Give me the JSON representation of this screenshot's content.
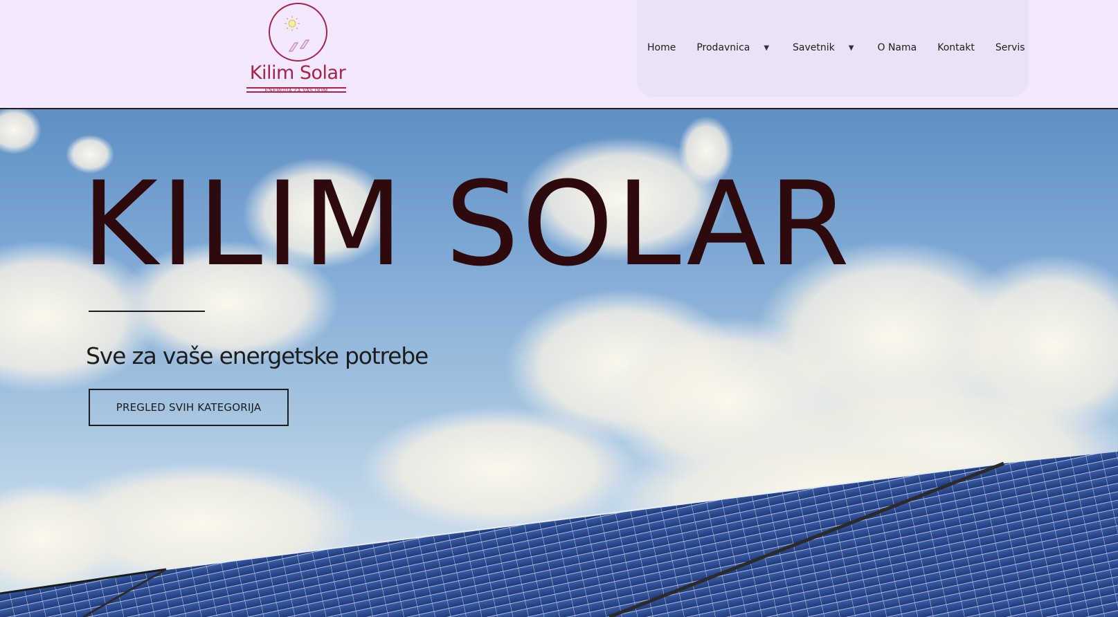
{
  "brand": {
    "name": "Kilim Solar",
    "tagline": "ENERGIJA ZA VAŠ DOM",
    "colors": {
      "primary": "#a8224a",
      "header_bg": "#f3e8fd"
    }
  },
  "nav": {
    "items": [
      {
        "label": "Home",
        "has_dropdown": false
      },
      {
        "label": "Prodavnica",
        "has_dropdown": true
      },
      {
        "label": "Savetnik",
        "has_dropdown": true
      },
      {
        "label": "O Nama",
        "has_dropdown": false
      },
      {
        "label": "Kontakt",
        "has_dropdown": false
      },
      {
        "label": "Servis",
        "has_dropdown": false
      }
    ],
    "dropdown_icon": "caret-down-icon"
  },
  "hero": {
    "title": "KILIM SOLAR",
    "subtitle": "Sve za vaše energetske potrebe",
    "button_label": "PREGLED SVIH KATEGORIJA",
    "background": "sky-with-clouds-and-solar-panels",
    "title_color": "#2e0a0c"
  }
}
